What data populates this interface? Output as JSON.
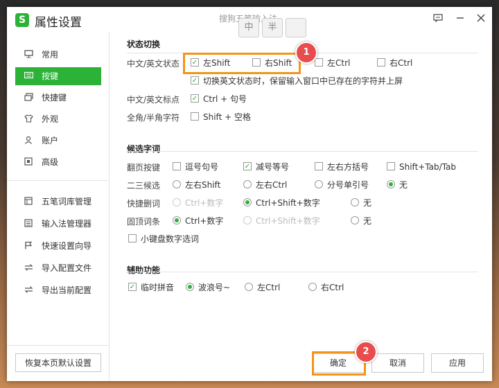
{
  "window": {
    "title": "属性设置",
    "ime_name": "搜狗五笔输入法",
    "ime_chip1": "中",
    "ime_chip2": "半"
  },
  "sidebar": {
    "items": [
      {
        "label": "常用",
        "icon": "monitor-icon"
      },
      {
        "label": "按键",
        "icon": "keyboard-icon",
        "active": true
      },
      {
        "label": "快捷键",
        "icon": "shortcut-icon"
      },
      {
        "label": "外观",
        "icon": "shirt-icon"
      },
      {
        "label": "账户",
        "icon": "user-icon"
      },
      {
        "label": "高级",
        "icon": "advanced-icon"
      }
    ],
    "tools": [
      {
        "label": "五笔词库管理",
        "icon": "dictionary-icon"
      },
      {
        "label": "输入法管理器",
        "icon": "manager-icon"
      },
      {
        "label": "快速设置向导",
        "icon": "flag-icon"
      },
      {
        "label": "导入配置文件",
        "icon": "import-icon"
      },
      {
        "label": "导出当前配置",
        "icon": "export-icon"
      }
    ],
    "restore_label": "恢复本页默认设置"
  },
  "status": {
    "title": "状态切换",
    "row1_label": "中文/英文状态",
    "opt_lshift": "左Shift",
    "opt_rshift": "右Shift",
    "opt_lctrl": "左Ctrl",
    "opt_rctrl": "右Ctrl",
    "keep_text": "切换英文状态时，保留输入窗口中已存在的字符并上屏",
    "punct_label": "中文/英文标点",
    "punct_opt": "Ctrl + 句号",
    "width_label": "全角/半角字符",
    "width_opt": "Shift + 空格"
  },
  "candidate": {
    "title": "候选字词",
    "page_label": "翻页按键",
    "page_opts": [
      "逗号句号",
      "减号等号",
      "左右方括号",
      "Shift+Tab/Tab"
    ],
    "two_label": "二三候选",
    "two_opts": [
      "左右Shift",
      "左右Ctrl",
      "分号单引号",
      "无"
    ],
    "del_label": "快捷删词",
    "del_opts": [
      "Ctrl+数字",
      "Ctrl+Shift+数字",
      "无"
    ],
    "pin_label": "固顶词条",
    "pin_opts": [
      "Ctrl+数字",
      "Ctrl+Shift+数字",
      "无"
    ],
    "numpad": "小键盘数字选词"
  },
  "aux": {
    "title": "辅助功能",
    "pinyin": "临时拼音",
    "opts": [
      "波浪号~",
      "左Ctrl",
      "右Ctrl"
    ]
  },
  "footer": {
    "ok": "确定",
    "cancel": "取消",
    "apply": "应用"
  },
  "annotations": {
    "badge1": "1",
    "badge2": "2"
  },
  "colors": {
    "accent": "#2db238",
    "highlight": "#f29418",
    "badge": "#e84c4c"
  }
}
